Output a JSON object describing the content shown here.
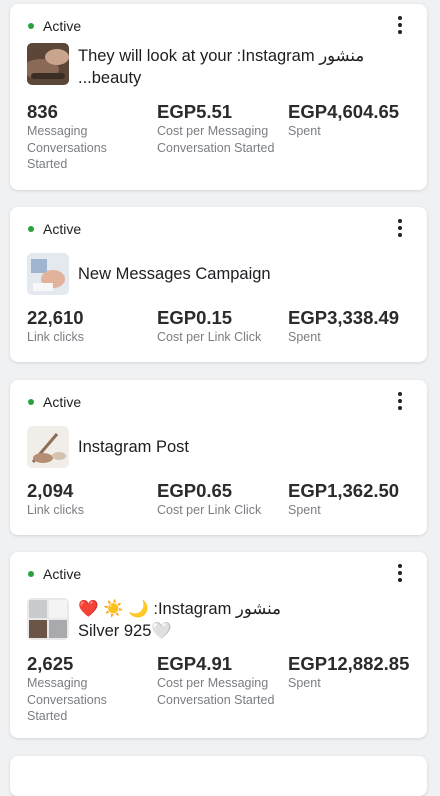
{
  "cards": [
    {
      "status": "Active",
      "title_line1": "They will look at your :Instagram منشور",
      "title_line2": "...beauty",
      "metrics": [
        {
          "value": "836",
          "label": "Messaging Conversations Started"
        },
        {
          "value": "EGP5.51",
          "label": "Cost per Messaging Conversation Started"
        },
        {
          "value": "EGP4,604.65",
          "label": "Spent"
        }
      ]
    },
    {
      "status": "Active",
      "title_line1": "New Messages Campaign",
      "metrics": [
        {
          "value": "22,610",
          "label": "Link clicks"
        },
        {
          "value": "EGP0.15",
          "label": "Cost per Link Click"
        },
        {
          "value": "EGP3,338.49",
          "label": "Spent"
        }
      ]
    },
    {
      "status": "Active",
      "title_line1": "Instagram Post",
      "metrics": [
        {
          "value": "2,094",
          "label": "Link clicks"
        },
        {
          "value": "EGP0.65",
          "label": "Cost per Link Click"
        },
        {
          "value": "EGP1,362.50",
          "label": "Spent"
        }
      ]
    },
    {
      "status": "Active",
      "title_line1": "❤️ ☀️ 🌙 :Instagram منشور",
      "title_line2": "Silver 925🤍",
      "metrics": [
        {
          "value": "2,625",
          "label": "Messaging Conversations Started"
        },
        {
          "value": "EGP4.91",
          "label": "Cost per Messaging Conversation Started"
        },
        {
          "value": "EGP12,882.85",
          "label": "Spent"
        }
      ]
    }
  ],
  "colors": {
    "active_dot": "#2aa23c",
    "background": "#f0f1f3",
    "card": "#ffffff"
  }
}
